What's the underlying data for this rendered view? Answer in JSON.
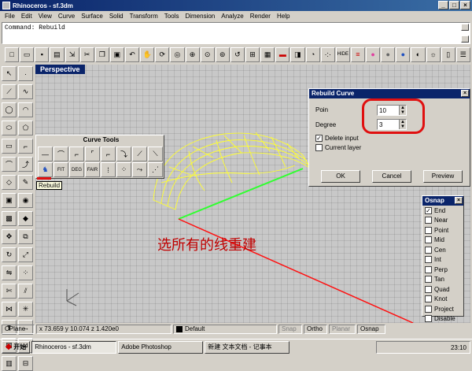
{
  "window": {
    "title": "Rhinoceros - sf.3dm"
  },
  "menu": [
    "File",
    "Edit",
    "View",
    "Curve",
    "Surface",
    "Solid",
    "Transform",
    "Tools",
    "Dimension",
    "Analyze",
    "Render",
    "Help"
  ],
  "command": {
    "line": "Command: Rebuild"
  },
  "viewport": {
    "label": "Perspective",
    "annotation": "选所有的线重建"
  },
  "curve_tools": {
    "title": "Curve Tools",
    "btn_fit": "FIT",
    "btn_deg": "DEG",
    "btn_fair": "FAIR"
  },
  "tooltip": "Rebuild",
  "toolbar": {
    "hide_label": "HIDE"
  },
  "rebuild_dialog": {
    "title": "Rebuild Curve",
    "point_count_label": "Poin",
    "point_count": "10",
    "degree_label": "Degree",
    "degree": "3",
    "delete_input_label": "Delete input",
    "current_layer_label": "Current layer",
    "ok_label": "OK",
    "cancel_label": "Cancel",
    "preview_label": "Preview"
  },
  "osnap": {
    "title": "Osnap",
    "items": [
      {
        "label": "End",
        "checked": true
      },
      {
        "label": "Near",
        "checked": false
      },
      {
        "label": "Point",
        "checked": false
      },
      {
        "label": "Mid",
        "checked": false
      },
      {
        "label": "Cen",
        "checked": false
      },
      {
        "label": "Int",
        "checked": false
      },
      {
        "label": "Perp",
        "checked": false
      },
      {
        "label": "Tan",
        "checked": false
      },
      {
        "label": "Quad",
        "checked": false
      },
      {
        "label": "Knot",
        "checked": false
      },
      {
        "label": "Project",
        "checked": false
      },
      {
        "label": "Disable",
        "checked": false
      }
    ]
  },
  "status": {
    "cplane": "CPlane",
    "coords": "x 73.659 y 10.074 z 1.420e0",
    "layer": "Default",
    "snap": "Snap",
    "ortho": "Ortho",
    "planar": "Planar",
    "osnap": "Osnap"
  },
  "taskbar": {
    "start": "开始",
    "tasks": [
      "Rhinoceros - sf.3dm",
      "Adobe Photoshop",
      "新建 文本文档 - 记事本"
    ],
    "clock": "23:10"
  }
}
